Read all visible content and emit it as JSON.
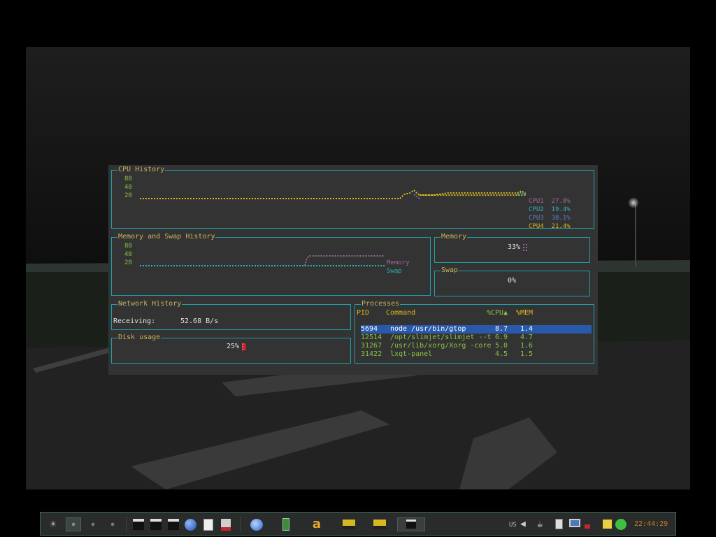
{
  "cpu_panel": {
    "title": "CPU History",
    "ticks": [
      "80",
      "40",
      "20"
    ],
    "legend": [
      {
        "label": "CPU1",
        "value": "27.8%",
        "color": "#9a6a9a"
      },
      {
        "label": "CPU2",
        "value": "19.4%",
        "color": "#30b3bb"
      },
      {
        "label": "CPU3",
        "value": "38.1%",
        "color": "#5f7fcf"
      },
      {
        "label": "CPU4",
        "value": "21.4%",
        "color": "#d9b91c"
      }
    ]
  },
  "mem_panel": {
    "title": "Memory and Swap History",
    "ticks": [
      "80",
      "40",
      "20"
    ],
    "legend": [
      {
        "label": "Memory",
        "color": "#9a6a9a"
      },
      {
        "label": "Swap",
        "color": "#30b3bb"
      }
    ]
  },
  "memory_gauge": {
    "title": "Memory",
    "value": "33%"
  },
  "swap_gauge": {
    "title": "Swap",
    "value": "0%"
  },
  "network": {
    "title": "Network History",
    "label": "Receiving:",
    "value": "52.68 B/s"
  },
  "disk": {
    "title": "Disk usage",
    "value": "25%"
  },
  "processes": {
    "title": "Processes",
    "headers": {
      "pid": "PID",
      "command": "Command",
      "cpu": "%CPU▲",
      "mem": "%MEM"
    },
    "rows": [
      {
        "pid": "5694",
        "command": "node /usr/bin/gtop",
        "cpu": "8.7",
        "mem": "1.4"
      },
      {
        "pid": "12514",
        "command": "/opt/slimjet/slimjet --t",
        "cpu": "6.9",
        "mem": "4.7"
      },
      {
        "pid": "31267",
        "command": "/usr/lib/xorg/Xorg -core",
        "cpu": "5.0",
        "mem": "1.6"
      },
      {
        "pid": "31422",
        "command": "lxqt-panel",
        "cpu": "4.5",
        "mem": "1.5"
      }
    ]
  },
  "taskbar": {
    "keyboard_layout": "US",
    "clock": "22:44:29",
    "icons": [
      "settings-sun-icon",
      "desktop-1",
      "desktop-2",
      "desktop-3",
      "desktop-4",
      "terminal-icon",
      "terminal-icon",
      "terminal-icon",
      "browser-globe-icon",
      "text-editor-icon",
      "task-manager-icon",
      "web-browser-icon",
      "battery-app-icon",
      "letter-a-app-icon",
      "window-app-icon",
      "window-app-icon",
      "terminal-window-icon",
      "volume-icon",
      "coffee-cup-icon",
      "clipboard-icon",
      "monitor-icon",
      "network-signal-icon",
      "sticky-note-icon",
      "status-green-icon"
    ]
  },
  "colors": {
    "border": "#1f9fa6",
    "title": "#c4b35a",
    "tick": "#88c140",
    "selected_row": "#2959ab",
    "terminal_bg": "#333334"
  }
}
